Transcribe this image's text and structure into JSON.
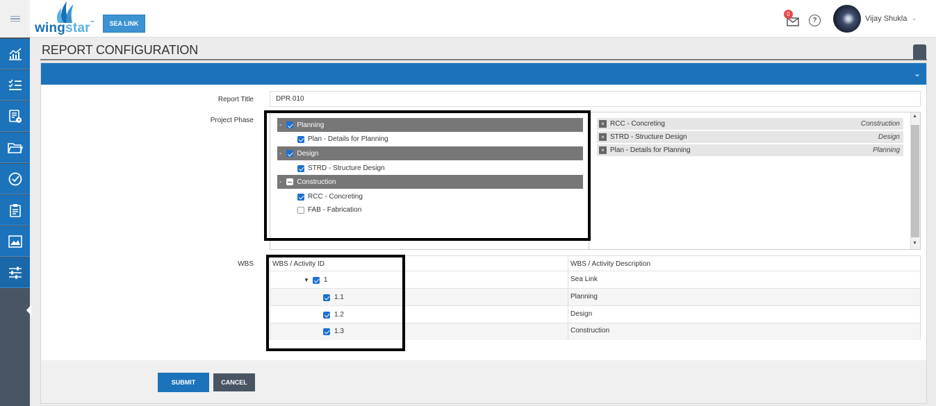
{
  "header": {
    "logo_text_1": "wing",
    "logo_text_2": "star",
    "logo_tm": "™",
    "project_button": "SEA LINK",
    "notification_count": "0",
    "help_glyph": "?",
    "user_name": "Vijay Shukla",
    "user_caret": "⌄"
  },
  "sidebar": {
    "items": [
      {
        "icon": "chart-icon"
      },
      {
        "icon": "checklist-icon"
      },
      {
        "icon": "report-clock-icon"
      },
      {
        "icon": "folder-icon"
      },
      {
        "icon": "check-circle-icon"
      },
      {
        "icon": "clipboard-icon"
      },
      {
        "icon": "image-icon"
      },
      {
        "icon": "sliders-icon"
      }
    ],
    "active_index": 7
  },
  "page": {
    "title": "REPORT CONFIGURATION",
    "panel_chevron": "⌄"
  },
  "form": {
    "report_title_label": "Report Title",
    "report_title_value": "DPR 010",
    "project_phase_label": "Project Phase",
    "wbs_label": "WBS"
  },
  "phases": [
    {
      "dash": "-",
      "name": "Planning",
      "state": "checked",
      "children": [
        {
          "name": "Plan - Details for Planning",
          "checked": true
        }
      ]
    },
    {
      "dash": "-",
      "name": "Design",
      "state": "checked",
      "children": [
        {
          "name": "STRD - Structure Design",
          "checked": true
        }
      ]
    },
    {
      "dash": "-",
      "name": "Construction",
      "state": "partial",
      "children": [
        {
          "name": "RCC - Concreting",
          "checked": true
        },
        {
          "name": "FAB - Fabrication",
          "checked": false
        }
      ]
    }
  ],
  "selected": [
    {
      "remove": "×",
      "name": "RCC - Concreting",
      "phase": "Construction"
    },
    {
      "remove": "×",
      "name": "STRD - Structure Design",
      "phase": "Design"
    },
    {
      "remove": "×",
      "name": "Plan - Details for Planning",
      "phase": "Planning"
    }
  ],
  "scroll": {
    "up": "▲",
    "down": "▼"
  },
  "wbs": {
    "col_id": "WBS / Activity ID",
    "col_desc": "WBS / Activity Description",
    "rows": [
      {
        "id": "1",
        "desc": "Sea Link",
        "checked": true,
        "caret": "▼"
      },
      {
        "id": "1.1",
        "desc": "Planning",
        "checked": true
      },
      {
        "id": "1.2",
        "desc": "Design",
        "checked": true
      },
      {
        "id": "1.3",
        "desc": "Construction",
        "checked": true
      }
    ]
  },
  "actions": {
    "submit": "SUBMIT",
    "cancel": "CANCEL"
  },
  "colors": {
    "primary": "#1c73bb",
    "sidebar": "#4a5563",
    "phase_row": "#777777",
    "badge": "#e8474b"
  }
}
